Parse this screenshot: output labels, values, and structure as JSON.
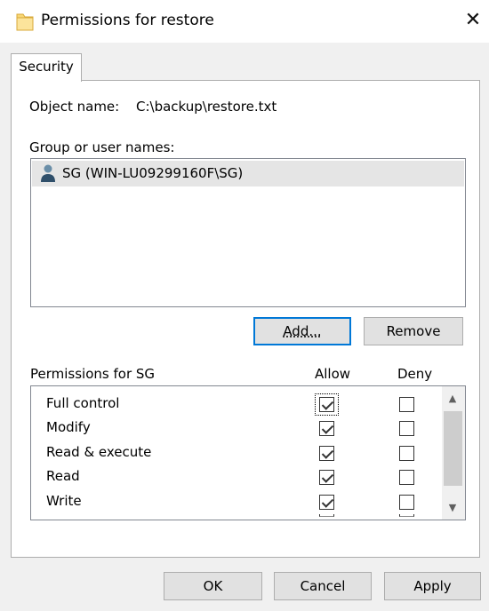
{
  "window": {
    "title": "Permissions for restore",
    "close_glyph": "✕",
    "icon": "folder-icon"
  },
  "tabs": [
    {
      "label": "Security",
      "selected": true
    }
  ],
  "object": {
    "label": "Object name:",
    "value": "C:\\backup\\restore.txt"
  },
  "group_label": "Group or user names:",
  "users": [
    {
      "label": "SG (WIN-LU09299160F\\SG)",
      "selected": true,
      "icon": "user-icon"
    }
  ],
  "buttons": {
    "add": "Add...",
    "remove": "Remove",
    "ok": "OK",
    "cancel": "Cancel",
    "apply": "Apply"
  },
  "permissions": {
    "header": "Permissions for SG",
    "allow_header": "Allow",
    "deny_header": "Deny",
    "rows": [
      {
        "name": "Full control",
        "allow": true,
        "deny": false
      },
      {
        "name": "Modify",
        "allow": true,
        "deny": false
      },
      {
        "name": "Read & execute",
        "allow": true,
        "deny": false
      },
      {
        "name": "Read",
        "allow": true,
        "deny": false
      },
      {
        "name": "Write",
        "allow": true,
        "deny": false
      }
    ]
  },
  "scroll": {
    "up_glyph": "▲",
    "down_glyph": "▼"
  },
  "colors": {
    "focus_border": "#0078d7",
    "selection": "#e5e5e5",
    "button_face": "#e1e1e1"
  }
}
